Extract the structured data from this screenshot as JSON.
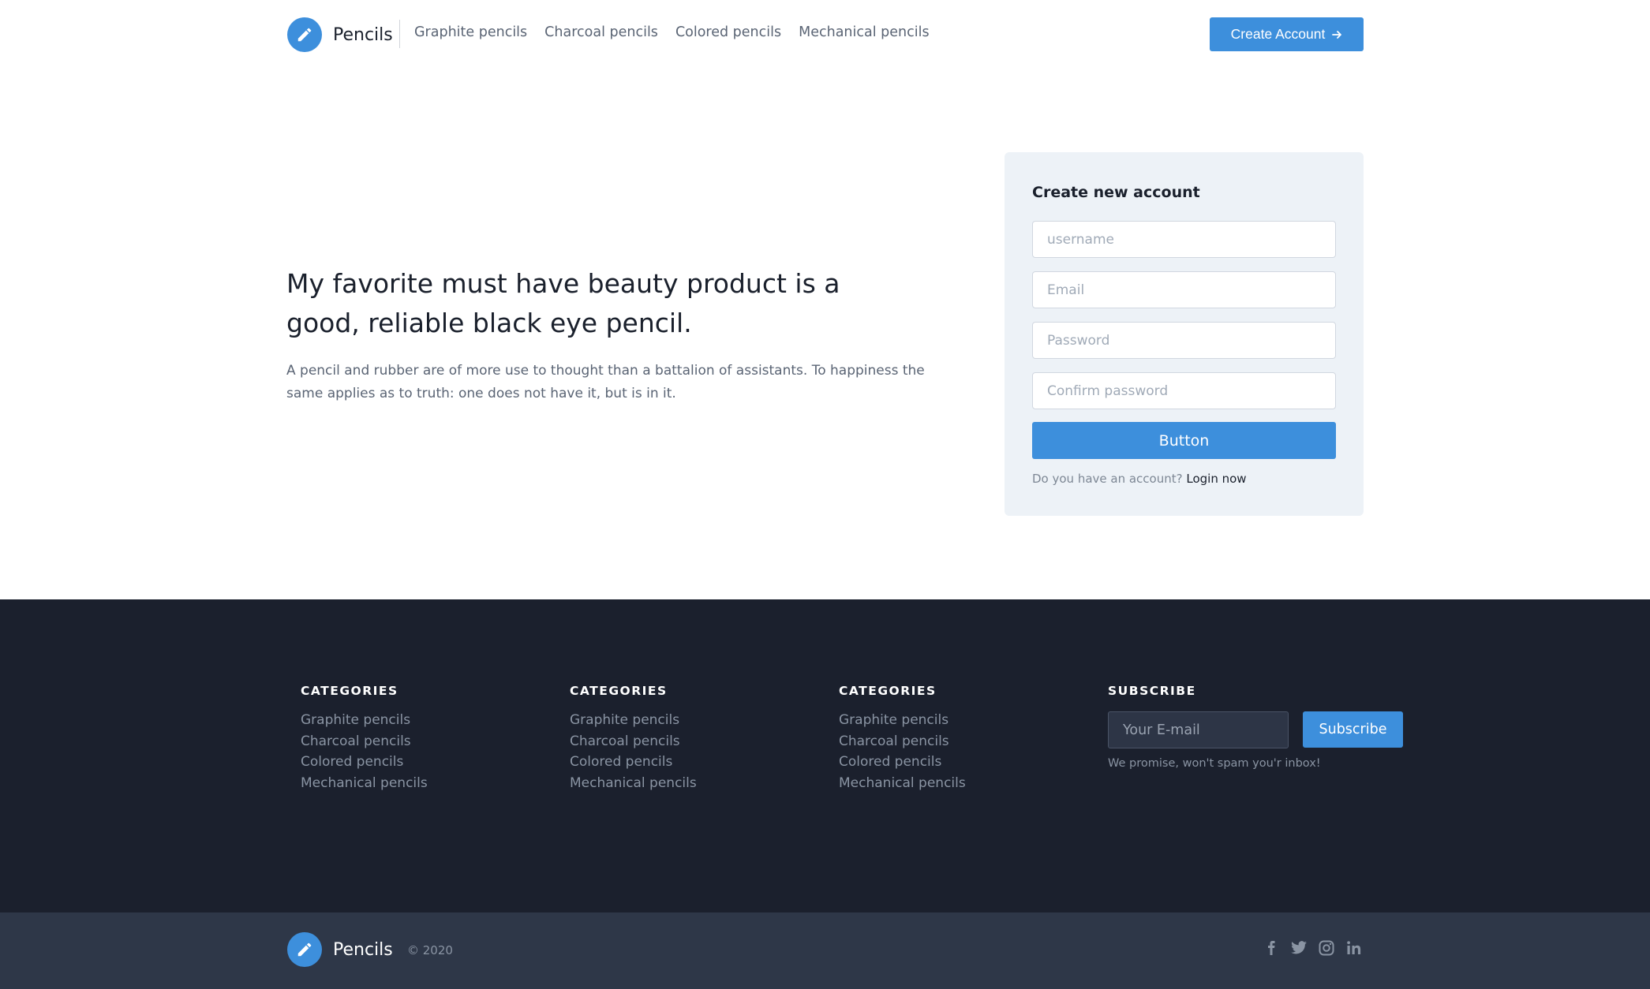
{
  "header": {
    "brand": "Pencils",
    "nav": [
      "Graphite pencils",
      "Charcoal pencils",
      "Colored pencils",
      "Mechanical pencils"
    ],
    "cta_label": "Create Account"
  },
  "hero": {
    "title": "My favorite must have beauty product is a good, reliable black eye pencil.",
    "text": "A pencil and rubber are of more use to thought than a battalion of assistants. To happiness the same applies as to truth: one does not have it, but is in it."
  },
  "form": {
    "title": "Create new account",
    "username_placeholder": "username",
    "email_placeholder": "Email",
    "password_placeholder": "Password",
    "confirm_placeholder": "Confirm password",
    "button_label": "Button",
    "login_prompt": "Do you have an account?",
    "login_link": "Login now"
  },
  "footer": {
    "columns": [
      {
        "heading": "CATEGORIES",
        "links": [
          "Graphite pencils",
          "Charcoal pencils",
          "Colored pencils",
          "Mechanical pencils"
        ]
      },
      {
        "heading": "CATEGORIES",
        "links": [
          "Graphite pencils",
          "Charcoal pencils",
          "Colored pencils",
          "Mechanical pencils"
        ]
      },
      {
        "heading": "CATEGORIES",
        "links": [
          "Graphite pencils",
          "Charcoal pencils",
          "Colored pencils",
          "Mechanical pencils"
        ]
      }
    ],
    "subscribe": {
      "heading": "SUBSCRIBE",
      "placeholder": "Your E-mail",
      "button_label": "Subscribe",
      "note": "We promise, won't spam you'r inbox!"
    },
    "bottom": {
      "brand": "Pencils",
      "copyright": "© 2020",
      "socials": [
        "facebook-icon",
        "twitter-icon",
        "instagram-icon",
        "linkedin-icon"
      ]
    }
  },
  "colors": {
    "accent": "#3d8fdc",
    "footer_dark": "#1b202d",
    "footer_bottom": "#2e3748",
    "card_bg": "#edf2f7"
  }
}
